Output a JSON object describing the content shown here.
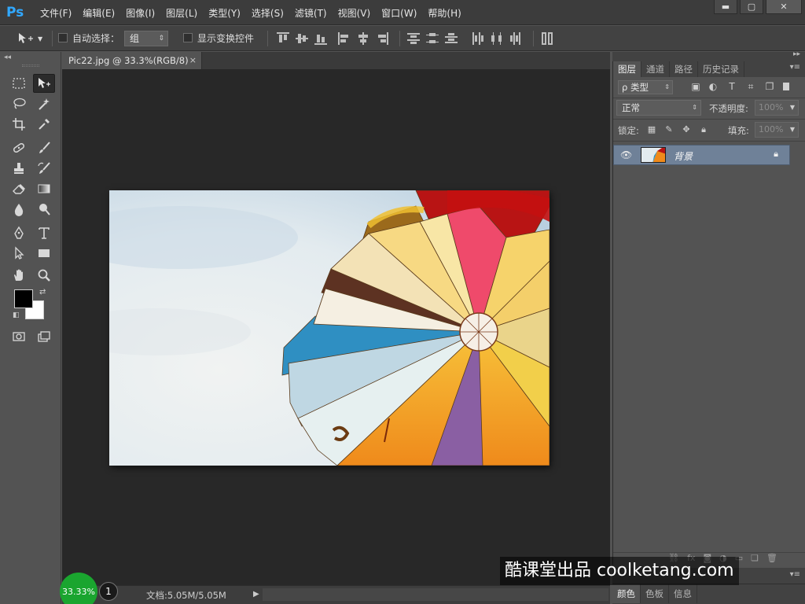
{
  "app": {
    "logo": "Ps"
  },
  "menu": [
    "文件(F)",
    "编辑(E)",
    "图像(I)",
    "图层(L)",
    "类型(Y)",
    "选择(S)",
    "滤镜(T)",
    "视图(V)",
    "窗口(W)",
    "帮助(H)"
  ],
  "window_controls": {
    "minimize": "▬",
    "maximize": "▢",
    "close": "✕"
  },
  "options_bar": {
    "auto_select_label": "自动选择：",
    "auto_select_checked": false,
    "auto_select_target": "组",
    "show_transform_label": "显示变换控件",
    "show_transform_checked": false
  },
  "document": {
    "tab_title": "Pic22.jpg @ 33.3%(RGB/8)",
    "tab_close": "×",
    "zoom": "33.33%",
    "doc_size": "文档:5.05M/5.05M"
  },
  "overlay": {
    "page_marker": "1",
    "watermark": "酷课堂出品 coolketang.com"
  },
  "layers_panel": {
    "tabs": [
      "图层",
      "通道",
      "路径",
      "历史记录"
    ],
    "active_tab": "图层",
    "filter_kind": "ρ 类型",
    "blend_mode": "正常",
    "opacity_label": "不透明度:",
    "opacity_value": "100%",
    "lock_label": "锁定:",
    "fill_label": "填充:",
    "fill_value": "100%",
    "layers": [
      {
        "name": "背景",
        "visible": true,
        "locked": true
      }
    ]
  },
  "bottom_panel": {
    "tabs": [
      "颜色",
      "色板",
      "信息"
    ],
    "active_tab": "颜色"
  },
  "colors": {
    "foreground": "#000000",
    "background": "#ffffff",
    "selected_layer": "#6f8198",
    "zoom_badge": "#1aa52f"
  },
  "tools": [
    "marquee-tool",
    "move-tool",
    "lasso-tool",
    "magic-wand-tool",
    "crop-tool",
    "eyedropper-tool",
    "healing-brush-tool",
    "brush-tool",
    "clone-stamp-tool",
    "history-brush-tool",
    "eraser-tool",
    "gradient-tool",
    "blur-tool",
    "dodge-tool",
    "pen-tool",
    "type-tool",
    "path-selection-tool",
    "rectangle-tool",
    "hand-tool",
    "zoom-tool",
    "quick-mask-button",
    "screen-mode-button"
  ]
}
